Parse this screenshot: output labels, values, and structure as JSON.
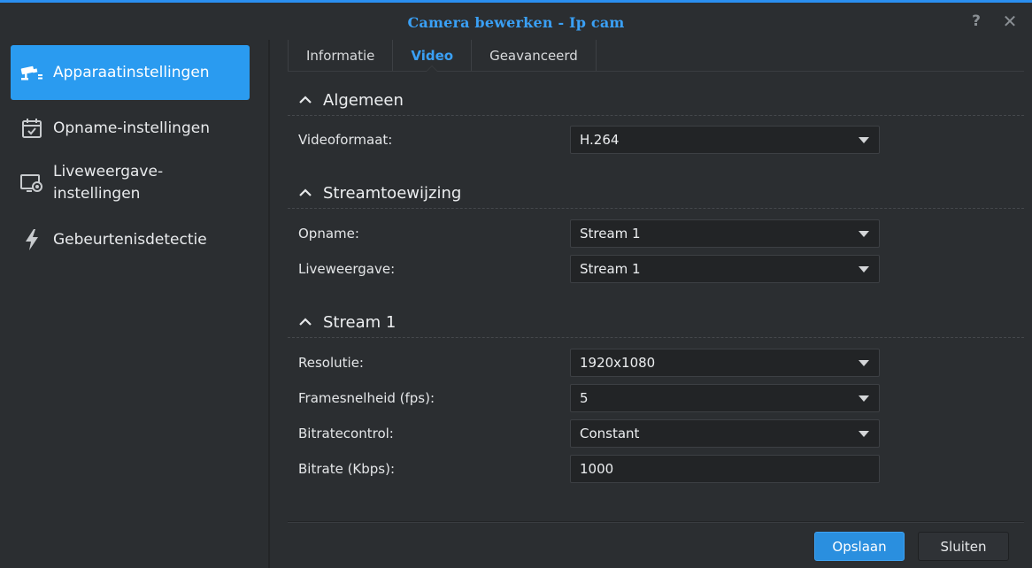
{
  "window": {
    "title": "Camera bewerken - Ip cam",
    "help_glyph": "?",
    "close_glyph": "✕"
  },
  "sidebar": {
    "items": [
      {
        "label": "Apparaatinstellingen",
        "icon": "camera-icon",
        "active": true
      },
      {
        "label": "Opname-instellingen",
        "icon": "calendar-icon",
        "active": false
      },
      {
        "label": "Liveweergave-instellingen",
        "label_line1": "Liveweergave-",
        "label_line2": "instellingen",
        "icon": "live-view-icon",
        "active": false
      },
      {
        "label": "Gebeurtenisdetectie",
        "icon": "lightning-icon",
        "active": false
      }
    ]
  },
  "tabs": [
    {
      "label": "Informatie",
      "active": false
    },
    {
      "label": "Video",
      "active": true
    },
    {
      "label": "Geavanceerd",
      "active": false
    }
  ],
  "sections": {
    "algemeen": {
      "title": "Algemeen",
      "videoformaat": {
        "label": "Videoformaat:",
        "value": "H.264"
      }
    },
    "stream_assign": {
      "title": "Streamtoewijzing",
      "opname": {
        "label": "Opname:",
        "value": "Stream 1"
      },
      "liveweergave": {
        "label": "Liveweergave:",
        "value": "Stream 1"
      }
    },
    "stream1": {
      "title": "Stream 1",
      "resolutie": {
        "label": "Resolutie:",
        "value": "1920x1080"
      },
      "fps": {
        "label": "Framesnelheid (fps):",
        "value": "5"
      },
      "bitratecontrol": {
        "label": "Bitratecontrol:",
        "value": "Constant"
      },
      "bitrate": {
        "label": "Bitrate (Kbps):",
        "value": "1000"
      }
    }
  },
  "footer": {
    "save_label": "Opslaan",
    "close_label": "Sluiten"
  },
  "colors": {
    "accent": "#2a9bf0",
    "title": "#3aa0f5",
    "background": "#2b2e31",
    "field_bg": "#222426"
  }
}
